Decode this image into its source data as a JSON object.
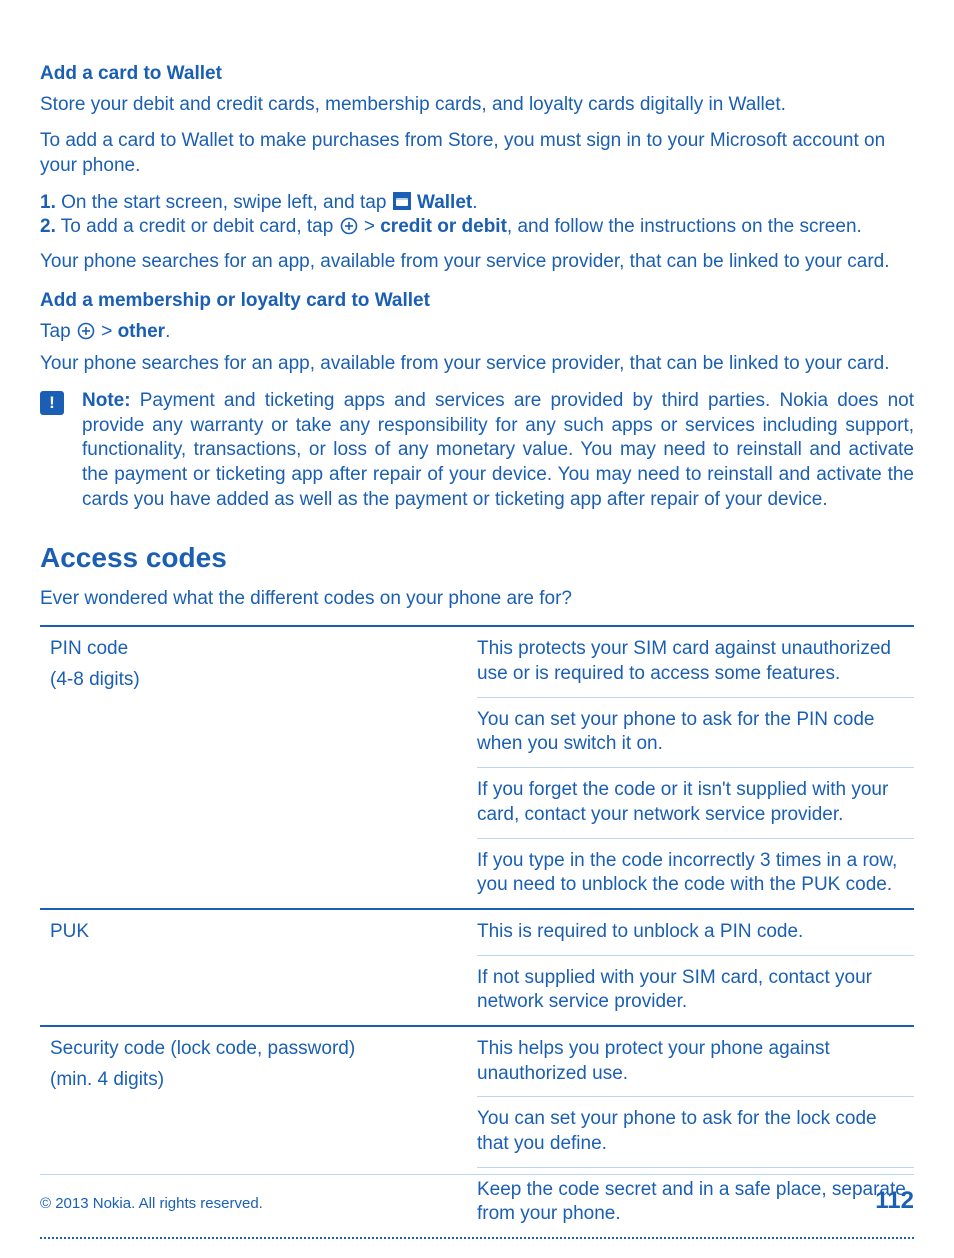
{
  "section1_heading": "Add a card to Wallet",
  "section1_para1": "Store your debit and credit cards, membership cards, and loyalty cards digitally in Wallet.",
  "section1_para2": "To add a card to Wallet to make purchases from Store, you must sign in to your Microsoft account on your phone.",
  "step1_num": "1.",
  "step1_text_a": " On the start screen, swipe left, and tap ",
  "step1_bold": "Wallet",
  "step1_tail": ".",
  "step2_num": "2.",
  "step2_text_a": " To add a credit or debit card, tap ",
  "step2_mid": " > ",
  "step2_bold": "credit or debit",
  "step2_tail": ", and follow the instructions on the screen.",
  "section1_para3": "Your phone searches for an app, available from your service provider, that can be linked to your card.",
  "section2_heading": "Add a membership or loyalty card to Wallet",
  "tap_text_a": "Tap ",
  "tap_mid": " > ",
  "tap_bold": "other",
  "tap_tail": ".",
  "section2_para1": "Your phone searches for an app, available from your service provider, that can be linked to your card.",
  "note_label": "Note: ",
  "note_body": "Payment and ticketing apps and services are provided by third parties. Nokia does not provide any warranty or take any responsibility for any such apps or services including support, functionality, transactions, or loss of any monetary value. You may need to reinstall and activate the payment or ticketing app after repair of your device. You may need to reinstall and activate the cards you have added as well as the payment or ticketing app after repair of your device.",
  "access_codes_heading": "Access codes",
  "access_codes_intro": "Ever wondered what the different codes on your phone are for?",
  "table": {
    "row1_term": "PIN code",
    "row1_subterm": "(4-8 digits)",
    "row1_cells": [
      "This protects your SIM card against unauthorized use or is required to access some features.",
      "You can set your phone to ask for the PIN code when you switch it on.",
      "If you forget the code or it isn't supplied with your card, contact your network service provider.",
      "If you type in the code incorrectly 3 times in a row, you need to unblock the code with the PUK code."
    ],
    "row2_term": "PUK",
    "row2_cells": [
      "This is required to unblock a PIN code.",
      "If not supplied with your SIM card, contact your network service provider."
    ],
    "row3_term": "Security code (lock code, password)",
    "row3_subterm": "(min. 4 digits)",
    "row3_cells": [
      "This helps you protect your phone against unauthorized use.",
      "You can set your phone to ask for the lock code that you define.",
      "Keep the code secret and in a safe place, separate from your phone."
    ]
  },
  "footer_text": "© 2013 Nokia. All rights reserved.",
  "footer_page": "112"
}
